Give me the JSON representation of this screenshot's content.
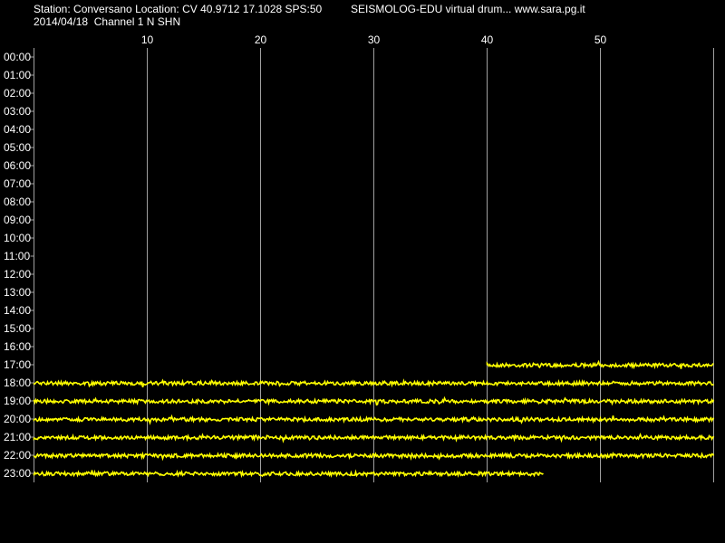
{
  "header": {
    "station_line": "Station: Conversano Location: CV 40.9712 17.1028 SPS:50",
    "title_line": "SEISMOLOG-EDU virtual drum... www.sara.pg.it",
    "date_line": "2014/04/18  Channel 1 N SHN"
  },
  "colors": {
    "background": "#000000",
    "trace": "#ffff00",
    "grid": "#a0a0a0",
    "text": "#ffffff"
  },
  "chart_data": {
    "type": "line",
    "title": "",
    "xlabel": "",
    "ylabel": "",
    "x_unit_note": "",
    "xlim": [
      0,
      60
    ],
    "x_ticks": [
      10,
      20,
      30,
      40,
      50
    ],
    "x_tick_labels": [
      "10",
      "20",
      "30",
      "40",
      "50"
    ],
    "y_tick_labels": [
      "00:00",
      "01:00",
      "02:00",
      "03:00",
      "04:00",
      "05:00",
      "06:00",
      "07:00",
      "08:00",
      "09:00",
      "10:00",
      "11:00",
      "12:00",
      "13:00",
      "14:00",
      "15:00",
      "16:00",
      "17:00",
      "18:00",
      "19:00",
      "20:00",
      "21:00",
      "22:00",
      "23:00"
    ],
    "grid": true,
    "traces": [
      {
        "hour": "17:00",
        "start": 40,
        "end": 60
      },
      {
        "hour": "18:00",
        "start": 0,
        "end": 60
      },
      {
        "hour": "19:00",
        "start": 0,
        "end": 60
      },
      {
        "hour": "20:00",
        "start": 0,
        "end": 60
      },
      {
        "hour": "21:00",
        "start": 0,
        "end": 60
      },
      {
        "hour": "22:00",
        "start": 0,
        "end": 60
      },
      {
        "hour": "23:00",
        "start": 0,
        "end": 45
      }
    ]
  }
}
